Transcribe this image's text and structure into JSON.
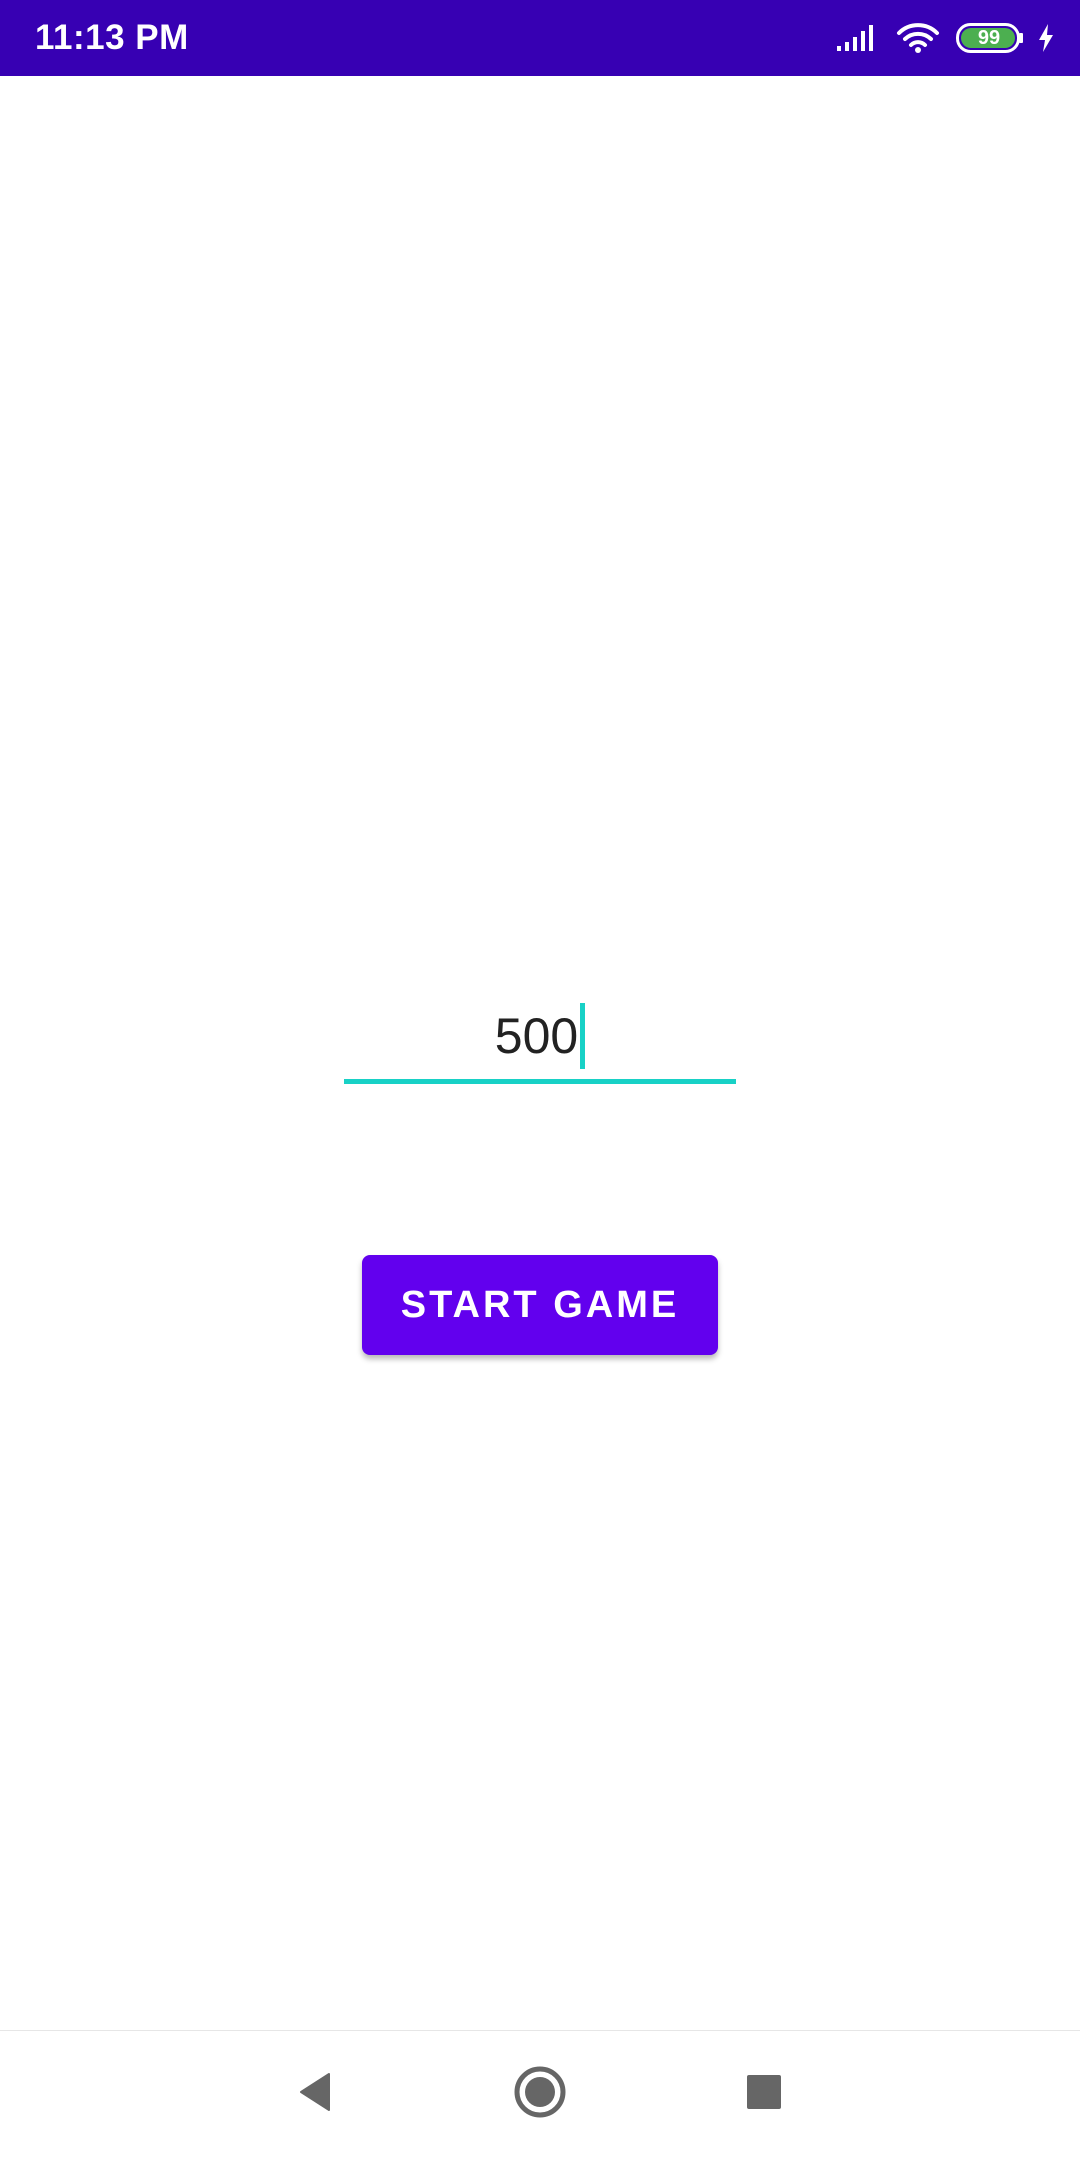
{
  "status_bar": {
    "time": "11:13 PM",
    "battery_level": "99",
    "background_color": "#3700b3",
    "icons": [
      "signal-icon",
      "wifi-icon",
      "battery-icon",
      "charging-icon"
    ]
  },
  "game_form": {
    "amount_value": "500",
    "start_button_label": "START GAME",
    "accent_color": "#18d1c6",
    "button_color": "#6200ee"
  },
  "nav_bar": {
    "icons": [
      "back-icon",
      "home-icon",
      "recents-icon"
    ]
  }
}
